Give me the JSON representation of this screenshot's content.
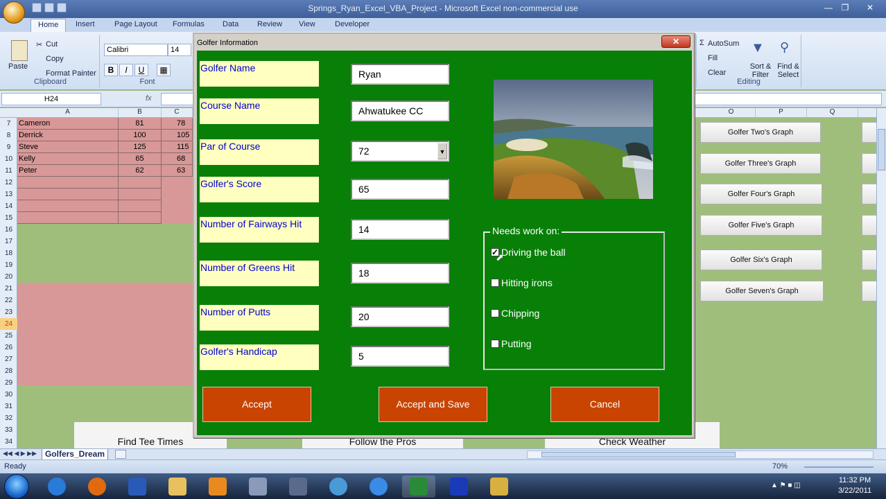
{
  "window": {
    "title": "Springs_Ryan_Excel_VBA_Project - Microsoft Excel non-commercial use"
  },
  "tabs": [
    "Home",
    "Insert",
    "Page Layout",
    "Formulas",
    "Data",
    "Review",
    "View",
    "Developer"
  ],
  "ribbon": {
    "clipboard": {
      "paste": "Paste",
      "cut": "Cut",
      "copy": "Copy",
      "format_painter": "Format Painter",
      "label": "Clipboard"
    },
    "font": {
      "name": "Calibri",
      "size": "14",
      "label": "Font",
      "bold": "B",
      "italic": "I",
      "underline": "U"
    },
    "editing": {
      "autosum": "AutoSum",
      "fill": "Fill",
      "clear": "Clear",
      "sort_filter": "Sort & Filter",
      "find_select": "Find & Select",
      "label": "Editing"
    }
  },
  "formula_bar": {
    "name_box": "H24",
    "fx": "fx"
  },
  "columns_left": [
    "A",
    "B",
    "C"
  ],
  "columns_right": [
    "O",
    "P",
    "Q"
  ],
  "rows": [
    "7",
    "8",
    "9",
    "10",
    "11",
    "12",
    "13",
    "14",
    "15",
    "16",
    "17",
    "18",
    "19",
    "20",
    "21",
    "22",
    "23",
    "24",
    "25",
    "26",
    "27",
    "28",
    "29",
    "30",
    "31",
    "32",
    "33",
    "34"
  ],
  "table": [
    {
      "name": "Cameron",
      "b": "81",
      "c": "78"
    },
    {
      "name": "Derrick",
      "b": "100",
      "c": "105"
    },
    {
      "name": "Steve",
      "b": "125",
      "c": "115"
    },
    {
      "name": "Kelly",
      "b": "65",
      "c": "68"
    },
    {
      "name": "Peter",
      "b": "62",
      "c": "63"
    }
  ],
  "graph_buttons": [
    "Golfer Two's Graph",
    "Golfer Three's Graph",
    "Golfer Four's Graph",
    "Golfer Five's Graph",
    "Golfer Six's Graph",
    "Golfer Seven's Graph"
  ],
  "bottom_buttons": [
    "Find Tee Times",
    "Follow the Pros",
    "Check Weather"
  ],
  "sheet_tab": "Golfers_Dream",
  "status": {
    "ready": "Ready",
    "zoom": "70%"
  },
  "clock": {
    "time": "11:32 PM",
    "date": "3/22/2011"
  },
  "dialog": {
    "title": "Golfer Information",
    "close": "x",
    "fields": [
      {
        "label": "Golfer Name",
        "value": "Ryan"
      },
      {
        "label": "Course Name",
        "value": "Ahwatukee CC"
      },
      {
        "label": "Par of Course",
        "value": "72"
      },
      {
        "label": "Golfer's Score",
        "value": "65"
      },
      {
        "label": "Number of Fairways Hit",
        "value": "14"
      },
      {
        "label": "Number of Greens Hit",
        "value": "18"
      },
      {
        "label": "Number of Putts",
        "value": "20"
      },
      {
        "label": "Golfer's Handicap",
        "value": "5"
      }
    ],
    "needs_work": {
      "label": "Needs work on:",
      "options": [
        {
          "label": "Driving the ball",
          "checked": true
        },
        {
          "label": "Hitting irons",
          "checked": false
        },
        {
          "label": "Chipping",
          "checked": false
        },
        {
          "label": "Putting",
          "checked": false
        }
      ]
    },
    "buttons": {
      "accept": "Accept",
      "accept_save": "Accept and Save",
      "cancel": "Cancel"
    }
  }
}
